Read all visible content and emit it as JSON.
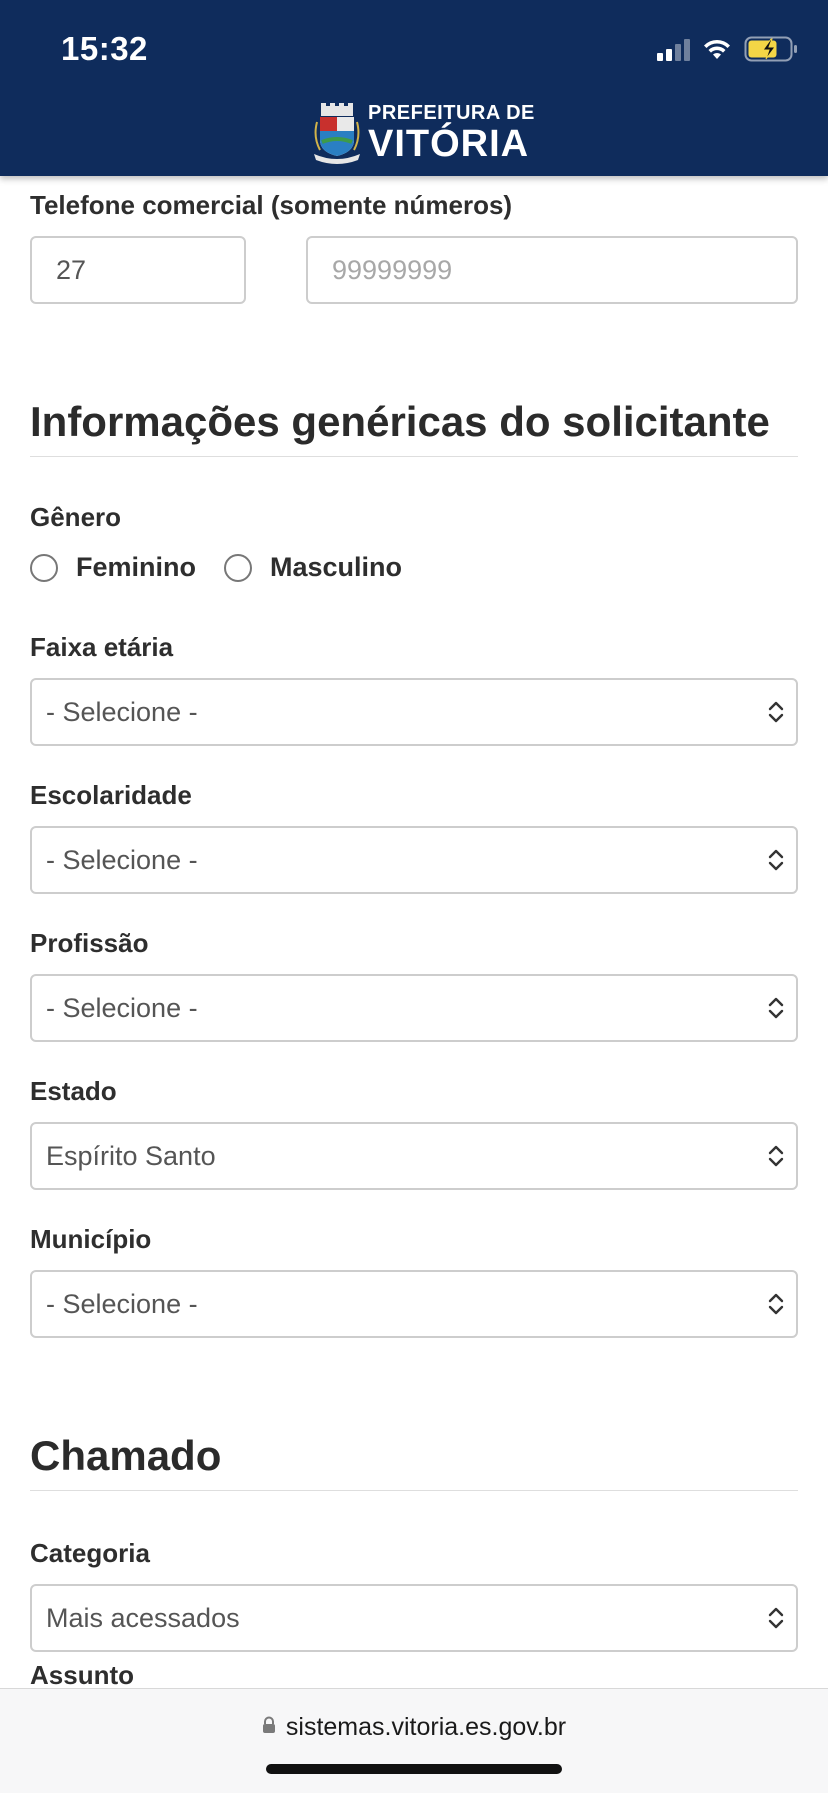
{
  "status": {
    "time": "15:32"
  },
  "header": {
    "logo_top": "PREFEITURA DE",
    "logo_main": "VITÓRIA"
  },
  "phone": {
    "label": "Telefone comercial (somente números)",
    "ddd_value": "27",
    "number_placeholder": "99999999"
  },
  "section_info": {
    "title": "Informações genéricas do solicitante"
  },
  "gender": {
    "label": "Gênero",
    "options": [
      "Feminino",
      "Masculino"
    ]
  },
  "age": {
    "label": "Faixa etária",
    "value": "- Selecione -"
  },
  "education": {
    "label": "Escolaridade",
    "value": "- Selecione -"
  },
  "profession": {
    "label": "Profissão",
    "value": "- Selecione -"
  },
  "state": {
    "label": "Estado",
    "value": "Espírito Santo"
  },
  "city": {
    "label": "Município",
    "value": "- Selecione -"
  },
  "section_call": {
    "title": "Chamado"
  },
  "category": {
    "label": "Categoria",
    "value": "Mais acessados"
  },
  "subject": {
    "label": "Assunto"
  },
  "browser": {
    "url": "sistemas.vitoria.es.gov.br"
  },
  "colors": {
    "header": "#0f2c5c",
    "battery": "#f4d646"
  }
}
